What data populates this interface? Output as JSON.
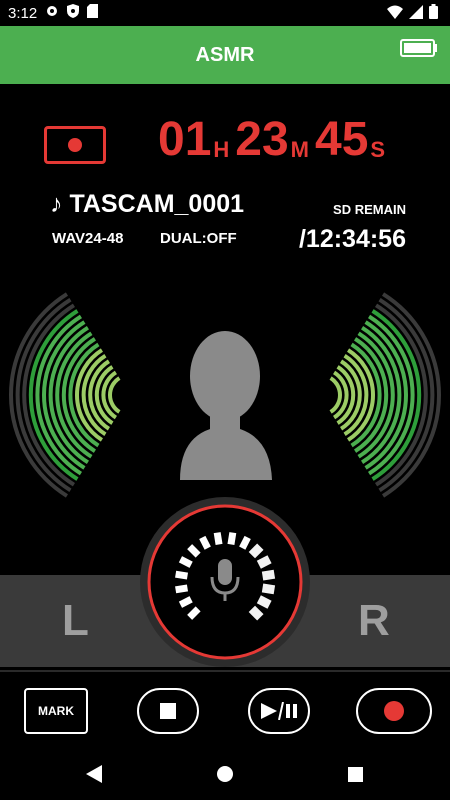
{
  "status_bar": {
    "time": "3:12",
    "icons": [
      "gear-icon",
      "shield-icon",
      "sd-card-icon",
      "wifi-icon",
      "signal-icon",
      "battery-icon"
    ]
  },
  "app_bar": {
    "title": "ASMR",
    "color": "#4caf50"
  },
  "recorder": {
    "state": "recording",
    "accent_color": "#e53935",
    "counter": {
      "hours": "01",
      "hours_unit": "H",
      "minutes": "23",
      "minutes_unit": "M",
      "seconds": "45",
      "seconds_unit": "S"
    },
    "file_name": "♪ TASCAM_0001",
    "format": "WAV24-48",
    "dual": "DUAL:OFF",
    "sd_label": "SD REMAIN",
    "sd_remain": "/12:34:56"
  },
  "meters": {
    "left_label": "L",
    "right_label": "R",
    "left_level": 0.8,
    "right_level": 0.8
  },
  "input_knob": {
    "icon": "microphone-icon",
    "level": 0.6
  },
  "controls": {
    "mark_label": "MARK",
    "stop_icon": "stop-icon",
    "play_pause_icon": "play-pause-icon",
    "record_icon": "record-icon"
  },
  "nav": {
    "back": "back-icon",
    "home": "home-icon",
    "recents": "recents-icon"
  }
}
